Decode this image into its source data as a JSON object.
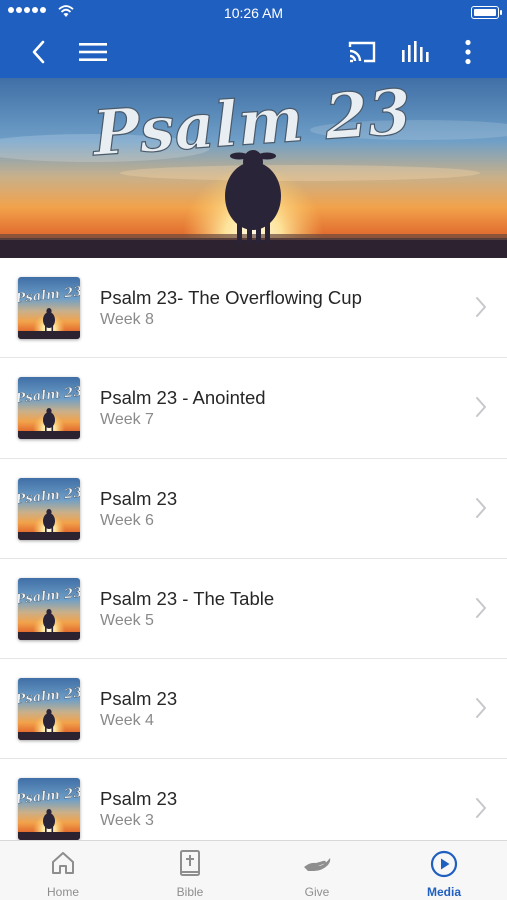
{
  "status_bar": {
    "time": "10:26 AM"
  },
  "hero": {
    "title": "Psalm 23"
  },
  "thumbnail_text": "Psalm 23",
  "items": [
    {
      "title": "Psalm 23- The Overflowing Cup",
      "subtitle": "Week 8"
    },
    {
      "title": "Psalm 23 - Anointed",
      "subtitle": "Week 7"
    },
    {
      "title": "Psalm 23",
      "subtitle": "Week 6"
    },
    {
      "title": "Psalm 23 - The Table",
      "subtitle": "Week 5"
    },
    {
      "title": "Psalm 23",
      "subtitle": "Week 4"
    },
    {
      "title": "Psalm 23",
      "subtitle": "Week 3"
    }
  ],
  "tabs": [
    {
      "label": "Home",
      "icon": "home-icon"
    },
    {
      "label": "Bible",
      "icon": "bible-icon"
    },
    {
      "label": "Give",
      "icon": "give-icon"
    },
    {
      "label": "Media",
      "icon": "media-play-icon",
      "active": true
    }
  ],
  "colors": {
    "primary": "#1f5fbf",
    "tab_inactive": "#8e8e8e"
  }
}
